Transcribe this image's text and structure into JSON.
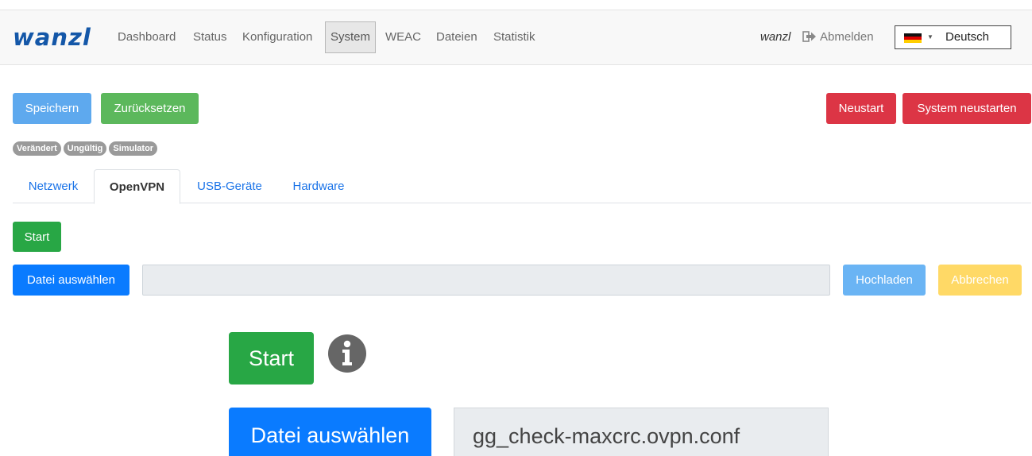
{
  "navbar": {
    "brand": "wanzl",
    "links": [
      {
        "label": "Dashboard",
        "active": false
      },
      {
        "label": "Status",
        "active": false
      },
      {
        "label": "Konfiguration",
        "active": false
      },
      {
        "label": "System",
        "active": true
      },
      {
        "label": "WEAC",
        "active": false
      },
      {
        "label": "Dateien",
        "active": false
      },
      {
        "label": "Statistik",
        "active": false
      }
    ],
    "user": "wanzl",
    "logout_label": "Abmelden",
    "logout_icon": "sign-out-icon",
    "language": {
      "selected": "Deutsch",
      "flag": "germany-flag-icon"
    }
  },
  "toolbar": {
    "save_label": "Speichern",
    "reset_label": "Zurücksetzen",
    "restart_label": "Neustart",
    "system_restart_label": "System neustarten"
  },
  "badges": [
    "Verändert",
    "Ungültig",
    "Simulator"
  ],
  "tabs": [
    {
      "label": "Netzwerk",
      "active": false
    },
    {
      "label": "OpenVPN",
      "active": true
    },
    {
      "label": "USB-Geräte",
      "active": false
    },
    {
      "label": "Hardware",
      "active": false
    }
  ],
  "openvpn": {
    "start_label": "Start",
    "choose_file_label": "Datei auswählen",
    "file_name": "",
    "upload_label": "Hochladen",
    "cancel_label": "Abbrechen"
  },
  "detail": {
    "start_label": "Start",
    "info_icon": "info-circle-icon",
    "choose_file_label": "Datei auswählen",
    "file_name": "gg_check-maxcrc.ovpn.conf"
  },
  "colors": {
    "brand": "#1457a8",
    "primary": "#0a7bff",
    "primary_light": "#5ea9ee",
    "success": "#28a745",
    "success_light": "#5cb85c",
    "danger": "#dc3545",
    "warning_light": "#ffd966",
    "badge": "#9a9a9a",
    "tab_link": "#1a73e8"
  }
}
